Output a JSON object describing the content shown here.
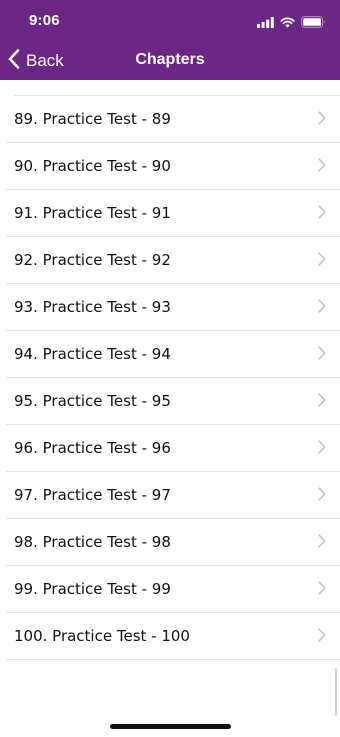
{
  "status_bar": {
    "time": "9:06",
    "icons": [
      "signal-icon",
      "wifi-icon",
      "battery-icon"
    ]
  },
  "nav": {
    "back_label": "Back",
    "title": "Chapters"
  },
  "chapters": [
    "89. Practice Test - 89",
    "90. Practice Test - 90",
    "91. Practice Test - 91",
    "92. Practice Test - 92",
    "93. Practice Test - 93",
    "94. Practice Test - 94",
    "95. Practice Test - 95",
    "96. Practice Test - 96",
    "97. Practice Test - 97",
    "98. Practice Test - 98",
    "99. Practice Test - 99",
    "100. Practice Test - 100"
  ],
  "colors": {
    "header_background": "#6a2785",
    "header_text": "#ffffff",
    "separator": "#e3e3e3",
    "chevron": "#c4c4c7"
  }
}
